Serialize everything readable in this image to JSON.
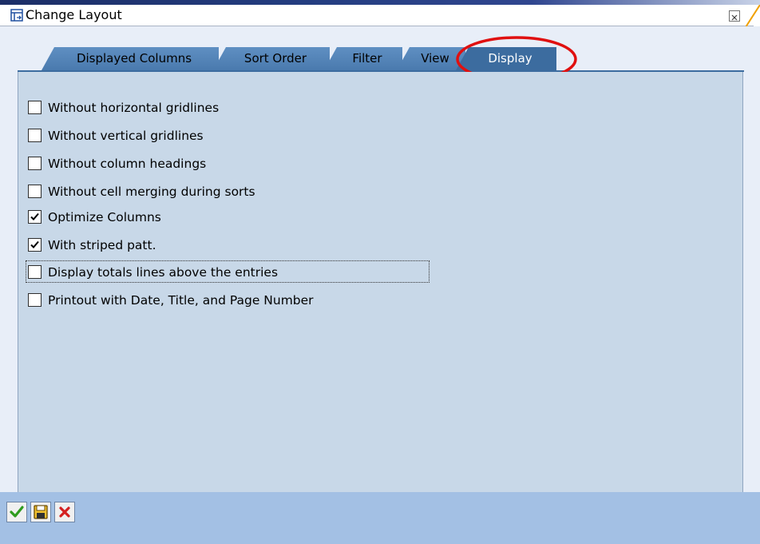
{
  "window": {
    "title": "Change Layout"
  },
  "tabs": [
    {
      "label": "Displayed Columns",
      "active": false
    },
    {
      "label": "Sort Order",
      "active": false
    },
    {
      "label": "Filter",
      "active": false
    },
    {
      "label": "View",
      "active": false
    },
    {
      "label": "Display",
      "active": true
    }
  ],
  "options": [
    {
      "label": "Without horizontal gridlines",
      "checked": false
    },
    {
      "label": "Without vertical gridlines",
      "checked": false
    },
    {
      "label": "Without column headings",
      "checked": false
    },
    {
      "label": "Without cell merging during sorts",
      "checked": false
    },
    {
      "label": "Optimize Columns",
      "checked": true
    },
    {
      "label": "With striped patt.",
      "checked": true
    },
    {
      "label": "Display totals lines above the entries",
      "checked": false,
      "focused": true
    },
    {
      "label": "Printout with Date, Title, and Page Number",
      "checked": false
    }
  ],
  "toolbar": {
    "buttons": [
      {
        "icon": "checkmark-icon",
        "color": "#2e9b1e"
      },
      {
        "icon": "save-icon",
        "color": "#e8b000"
      },
      {
        "icon": "cancel-icon",
        "color": "#d42020"
      }
    ]
  },
  "colors": {
    "tab_active": "#3c6c9f",
    "tab_inactive": "#5f8fc2",
    "panel": "#c8d8e8",
    "bottom_bar": "#a3c0e4",
    "annotation": "#e01010"
  }
}
